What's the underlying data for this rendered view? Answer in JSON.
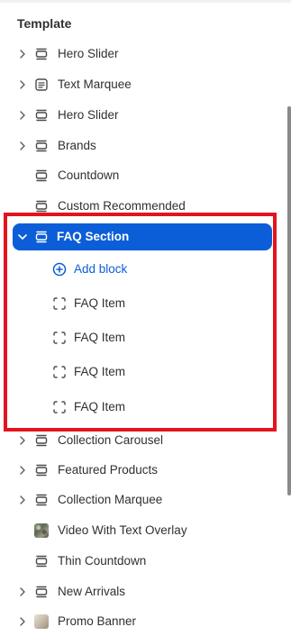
{
  "panel": {
    "heading": "Template",
    "items": [
      {
        "label": "Hero Slider",
        "icon": "section-icon",
        "expandable": true
      },
      {
        "label": "Text Marquee",
        "icon": "text-section-icon",
        "expandable": true
      },
      {
        "label": "Hero Slider",
        "icon": "section-icon",
        "expandable": true
      },
      {
        "label": "Brands",
        "icon": "section-icon",
        "expandable": true
      },
      {
        "label": "Countdown",
        "icon": "section-icon",
        "expandable": false
      },
      {
        "label": "Custom Recommended",
        "icon": "section-icon",
        "expandable": false
      }
    ],
    "selected": {
      "label": "FAQ Section",
      "icon": "section-icon",
      "expanded": true
    },
    "children": {
      "add_block": "Add block",
      "blocks": [
        {
          "label": "FAQ Item",
          "icon": "block-icon"
        },
        {
          "label": "FAQ Item",
          "icon": "block-icon"
        },
        {
          "label": "FAQ Item",
          "icon": "block-icon"
        },
        {
          "label": "FAQ Item",
          "icon": "block-icon"
        }
      ]
    },
    "items_after": [
      {
        "label": "Collection Carousel",
        "icon": "section-icon",
        "expandable": true
      },
      {
        "label": "Featured Products",
        "icon": "section-icon",
        "expandable": true
      },
      {
        "label": "Collection Marquee",
        "icon": "section-icon",
        "expandable": true
      },
      {
        "label": "Video With Text Overlay",
        "icon": "video-thumbnail",
        "expandable": false
      },
      {
        "label": "Thin Countdown",
        "icon": "section-icon",
        "expandable": false
      },
      {
        "label": "New Arrivals",
        "icon": "section-icon",
        "expandable": true
      },
      {
        "label": "Promo Banner",
        "icon": "image-thumbnail",
        "expandable": true
      }
    ]
  },
  "colors": {
    "accent": "#0b5ed7",
    "highlight": "#e3141d",
    "text": "#303030"
  }
}
